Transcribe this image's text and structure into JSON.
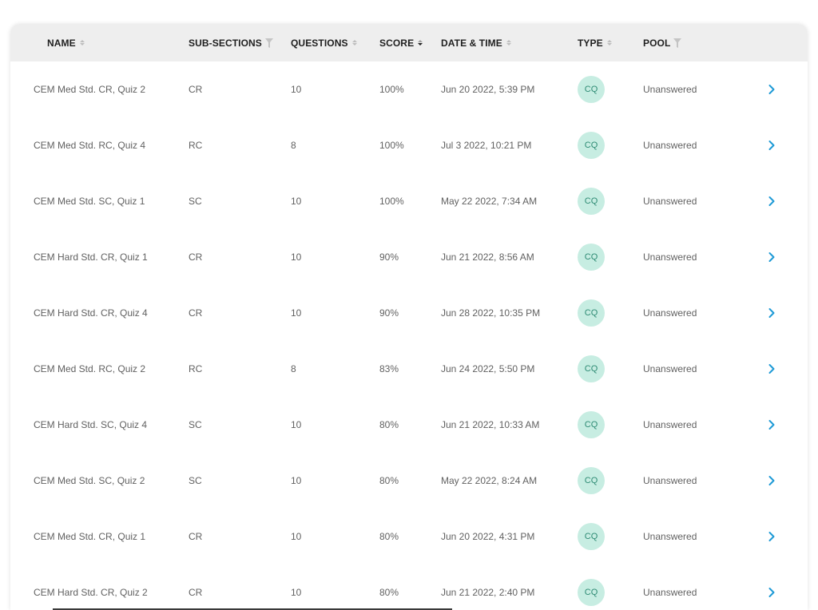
{
  "columns": {
    "name": "NAME",
    "subsections": "SUB-SECTIONS",
    "questions": "QUESTIONS",
    "score": "SCORE",
    "datetime": "DATE & TIME",
    "type": "TYPE",
    "pool": "POOL"
  },
  "colors": {
    "header_bg": "#eeeeee",
    "badge_bg": "#c7ede2",
    "badge_text": "#2e8b74",
    "chevron": "#1e9ad6"
  },
  "rows": [
    {
      "name": "CEM Med Std. CR, Quiz 2",
      "subsection": "CR",
      "questions": "10",
      "score": "100%",
      "datetime": "Jun 20 2022, 5:39 PM",
      "type": "CQ",
      "pool": "Unanswered"
    },
    {
      "name": "CEM Med Std. RC, Quiz 4",
      "subsection": "RC",
      "questions": "8",
      "score": "100%",
      "datetime": "Jul 3 2022, 10:21 PM",
      "type": "CQ",
      "pool": "Unanswered"
    },
    {
      "name": "CEM Med Std. SC, Quiz 1",
      "subsection": "SC",
      "questions": "10",
      "score": "100%",
      "datetime": "May 22 2022, 7:34 AM",
      "type": "CQ",
      "pool": "Unanswered"
    },
    {
      "name": "CEM Hard Std. CR, Quiz 1",
      "subsection": "CR",
      "questions": "10",
      "score": "90%",
      "datetime": "Jun 21 2022, 8:56 AM",
      "type": "CQ",
      "pool": "Unanswered"
    },
    {
      "name": "CEM Hard Std. CR, Quiz 4",
      "subsection": "CR",
      "questions": "10",
      "score": "90%",
      "datetime": "Jun 28 2022, 10:35 PM",
      "type": "CQ",
      "pool": "Unanswered"
    },
    {
      "name": "CEM Med Std. RC, Quiz 2",
      "subsection": "RC",
      "questions": "8",
      "score": "83%",
      "datetime": "Jun 24 2022, 5:50 PM",
      "type": "CQ",
      "pool": "Unanswered"
    },
    {
      "name": "CEM Hard Std. SC, Quiz 4",
      "subsection": "SC",
      "questions": "10",
      "score": "80%",
      "datetime": "Jun 21 2022, 10:33 AM",
      "type": "CQ",
      "pool": "Unanswered"
    },
    {
      "name": "CEM Med Std. SC, Quiz 2",
      "subsection": "SC",
      "questions": "10",
      "score": "80%",
      "datetime": "May 22 2022, 8:24 AM",
      "type": "CQ",
      "pool": "Unanswered"
    },
    {
      "name": "CEM Med Std. CR, Quiz 1",
      "subsection": "CR",
      "questions": "10",
      "score": "80%",
      "datetime": "Jun 20 2022, 4:31 PM",
      "type": "CQ",
      "pool": "Unanswered"
    },
    {
      "name": "CEM Hard Std. CR, Quiz 2",
      "subsection": "CR",
      "questions": "10",
      "score": "80%",
      "datetime": "Jun 21 2022, 2:40 PM",
      "type": "CQ",
      "pool": "Unanswered"
    }
  ]
}
